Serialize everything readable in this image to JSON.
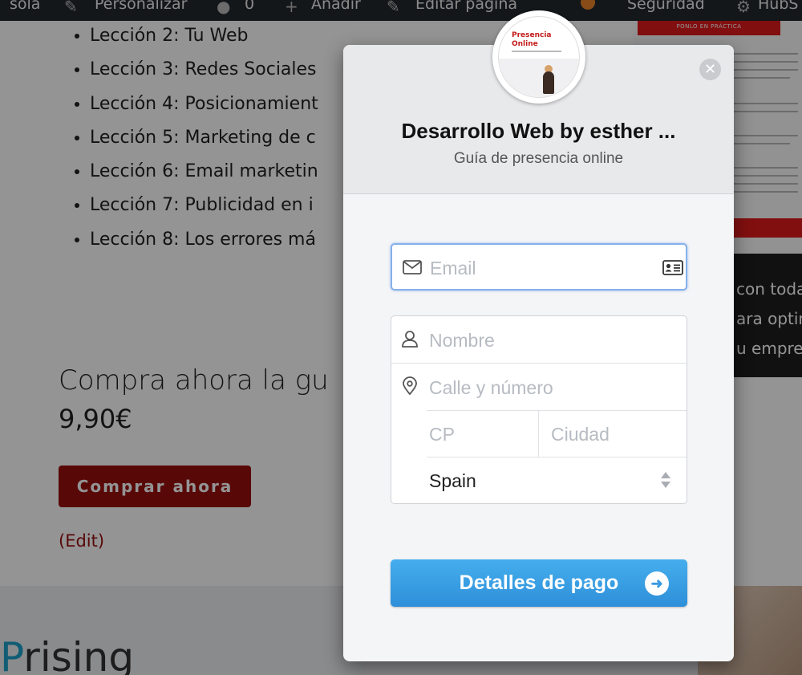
{
  "admin_bar": {
    "items": [
      "sola",
      "Personalizar",
      "0",
      "Añadir",
      "Editar página",
      "Seguridad",
      "HubS"
    ]
  },
  "page": {
    "lessons": [
      "Lección 2: Tu Web",
      "Lección 3: Redes Sociales",
      "Lección 4: Posicionamient",
      "Lección 5: Marketing de c",
      "Lección 6: Email marketin",
      "Lección 7: Publicidad en i",
      "Lección 8: Los errores má"
    ],
    "buy_title": "Compra ahora la gu",
    "price": "9,90€",
    "buy_button": "Comprar ahora",
    "edit_link": "(Edit)",
    "rising": "rising",
    "rising_prefix": "P",
    "doc_banner": "PONLO EN PRÁCTICA",
    "dark_lines": [
      "con toda",
      "ara optim",
      "u empres"
    ]
  },
  "modal": {
    "logo_text": "Presencia Online",
    "shop_name": "Desarrollo Web by esther ...",
    "description": "Guía de presencia online",
    "close_symbol": "✕",
    "email_placeholder": "Email",
    "name_placeholder": "Nombre",
    "street_placeholder": "Calle y número",
    "zip_placeholder": "CP",
    "city_placeholder": "Ciudad",
    "country_value": "Spain",
    "pay_button": "Detalles de pago",
    "pay_arrow": "➜"
  },
  "colors": {
    "accent_blue": "#3a9ae3",
    "brand_red": "#9a0e0e",
    "focus_border": "#86b1ea"
  },
  "icons": [
    "envelope-icon",
    "contact-card-icon",
    "user-icon",
    "location-pin-icon",
    "select-arrows-icon",
    "close-icon",
    "arrow-right-icon"
  ]
}
